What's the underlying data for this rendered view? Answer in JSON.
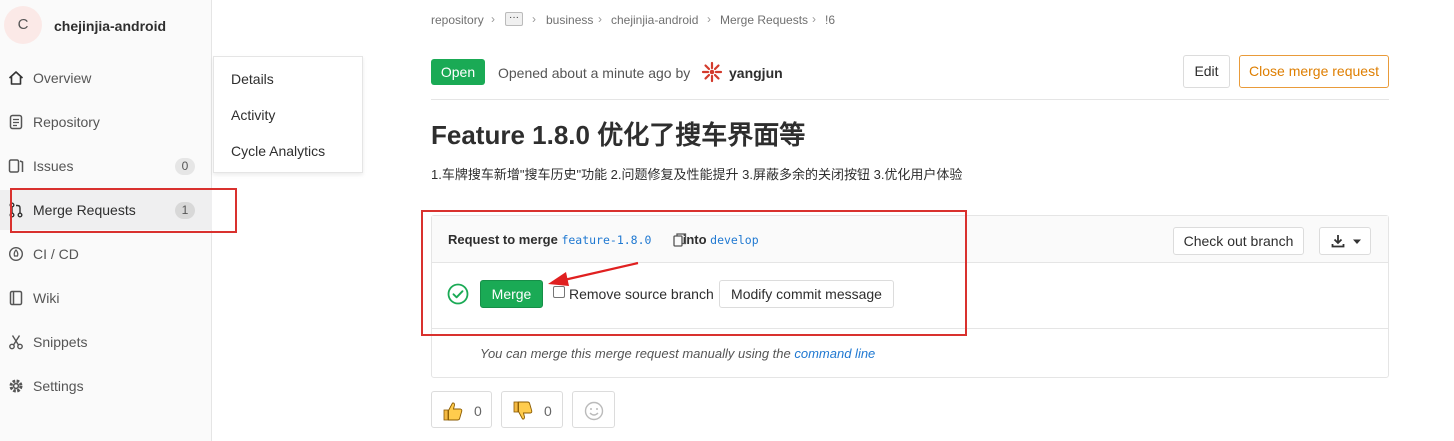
{
  "project": {
    "avatar_letter": "C",
    "name": "chejinjia-android"
  },
  "sidebar": {
    "items": [
      {
        "label": "Overview",
        "icon": "home-icon"
      },
      {
        "label": "Repository",
        "icon": "doc-icon"
      },
      {
        "label": "Issues",
        "icon": "issues-icon",
        "count": "0"
      },
      {
        "label": "Merge Requests",
        "icon": "merge-request-icon",
        "count": "1"
      },
      {
        "label": "CI / CD",
        "icon": "rocket-icon"
      },
      {
        "label": "Wiki",
        "icon": "book-icon"
      },
      {
        "label": "Snippets",
        "icon": "scissors-icon"
      },
      {
        "label": "Settings",
        "icon": "gear-icon"
      }
    ],
    "flyout": [
      "Details",
      "Activity",
      "Cycle Analytics"
    ]
  },
  "breadcrumb": {
    "items": [
      "repository",
      "business",
      "chejinjia-android",
      "Merge Requests",
      "!6"
    ],
    "ellipsis": "···"
  },
  "header": {
    "status": "Open",
    "opened_text": "Opened about a minute ago by",
    "author": "yangjun",
    "edit_label": "Edit",
    "close_label": "Close merge request"
  },
  "mr": {
    "title": "Feature 1.8.0 优化了搜车界面等",
    "description": "1.车牌搜车新增\"搜车历史\"功能 2.问题修复及性能提升 3.屏蔽多余的关闭按钮 3.优化用户体验"
  },
  "widget": {
    "request_prefix": "Request to merge",
    "source_branch": "feature-1.8.0",
    "into": "into",
    "target_branch": "develop",
    "checkout_label": "Check out branch",
    "merge_label": "Merge",
    "remove_source_label": "Remove source branch",
    "modify_commit_label": "Modify commit message",
    "manual_text": "You can merge this merge request manually using the",
    "manual_link": "command line"
  },
  "awards": {
    "thumbsup_count": "0",
    "thumbsdown_count": "0"
  },
  "colors": {
    "success": "#1aaa55",
    "warning": "#de7e00",
    "link": "#1f78d1",
    "annotation": "#d9312e"
  }
}
